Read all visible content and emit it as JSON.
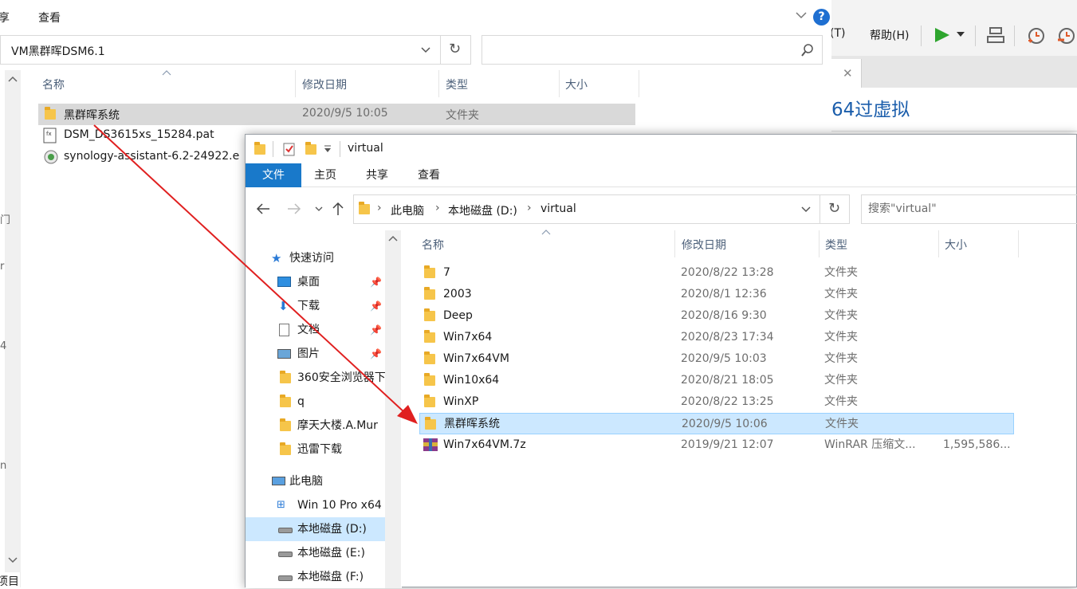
{
  "vmware": {
    "menu": [
      "(T)",
      "帮助(H)"
    ],
    "title": "64过虚拟"
  },
  "bg_window": {
    "ribbon_tabs": [
      "享",
      "查看"
    ],
    "address": "VM黑群晖DSM6.1",
    "columns": [
      "名称",
      "修改日期",
      "类型",
      "大小"
    ],
    "rows": [
      {
        "name": "黑群晖系统",
        "date": "2020/9/5 10:05",
        "type": "文件夹",
        "size": ""
      },
      {
        "name": "DSM_DS3615xs_15284.pat",
        "date": "",
        "type": "",
        "size": ""
      },
      {
        "name": "synology-assistant-6.2-24922.e",
        "date": "",
        "type": "",
        "size": ""
      }
    ],
    "status": "项目"
  },
  "fg_window": {
    "title": "virtual",
    "ribbon_tabs": [
      "文件",
      "主页",
      "共享",
      "查看"
    ],
    "breadcrumb": [
      "此电脑",
      "本地磁盘 (D:)",
      "virtual"
    ],
    "search_placeholder": "搜索\"virtual\"",
    "columns": [
      "名称",
      "修改日期",
      "类型",
      "大小"
    ],
    "nav": [
      {
        "label": "快速访问",
        "icon": "star-icon",
        "pinned": false
      },
      {
        "label": "桌面",
        "icon": "desktop-icon",
        "pinned": true
      },
      {
        "label": "下载",
        "icon": "download-icon",
        "pinned": true
      },
      {
        "label": "文档",
        "icon": "document-icon",
        "pinned": true
      },
      {
        "label": "图片",
        "icon": "picture-icon",
        "pinned": true
      },
      {
        "label": "360安全浏览器下",
        "icon": "folder-icon",
        "pinned": false
      },
      {
        "label": "q",
        "icon": "folder-icon",
        "pinned": false
      },
      {
        "label": "摩天大楼.A.Mur",
        "icon": "folder-icon",
        "pinned": false
      },
      {
        "label": "迅雷下载",
        "icon": "folder-icon",
        "pinned": false
      },
      {
        "label": "此电脑",
        "icon": "computer-icon",
        "pinned": false
      },
      {
        "label": "Win 10 Pro x64",
        "icon": "windows-drive-icon",
        "pinned": false
      },
      {
        "label": "本地磁盘 (D:)",
        "icon": "drive-icon",
        "pinned": false
      },
      {
        "label": "本地磁盘 (E:)",
        "icon": "drive-icon",
        "pinned": false
      },
      {
        "label": "本地磁盘 (F:)",
        "icon": "drive-icon",
        "pinned": false
      }
    ],
    "files": [
      {
        "name": "7",
        "date": "2020/8/22 13:28",
        "type": "文件夹",
        "size": ""
      },
      {
        "name": "2003",
        "date": "2020/8/1 12:36",
        "type": "文件夹",
        "size": ""
      },
      {
        "name": "Deep",
        "date": "2020/8/16 9:30",
        "type": "文件夹",
        "size": ""
      },
      {
        "name": "Win7x64",
        "date": "2020/8/23 17:34",
        "type": "文件夹",
        "size": ""
      },
      {
        "name": "Win7x64VM",
        "date": "2020/9/5 10:03",
        "type": "文件夹",
        "size": ""
      },
      {
        "name": "Win10x64",
        "date": "2020/8/21 18:05",
        "type": "文件夹",
        "size": ""
      },
      {
        "name": "WinXP",
        "date": "2020/8/22 13:25",
        "type": "文件夹",
        "size": ""
      },
      {
        "name": "黑群晖系统",
        "date": "2020/9/5 10:06",
        "type": "文件夹",
        "size": ""
      },
      {
        "name": "Win7x64VM.7z",
        "date": "2019/9/21 12:07",
        "type": "WinRAR 压缩文...",
        "size": "1,595,586..."
      }
    ]
  },
  "colors": {
    "accent": "#1979ca",
    "selection": "#cce8ff",
    "arrow": "#e02020",
    "vm_title": "#1a5dab"
  }
}
